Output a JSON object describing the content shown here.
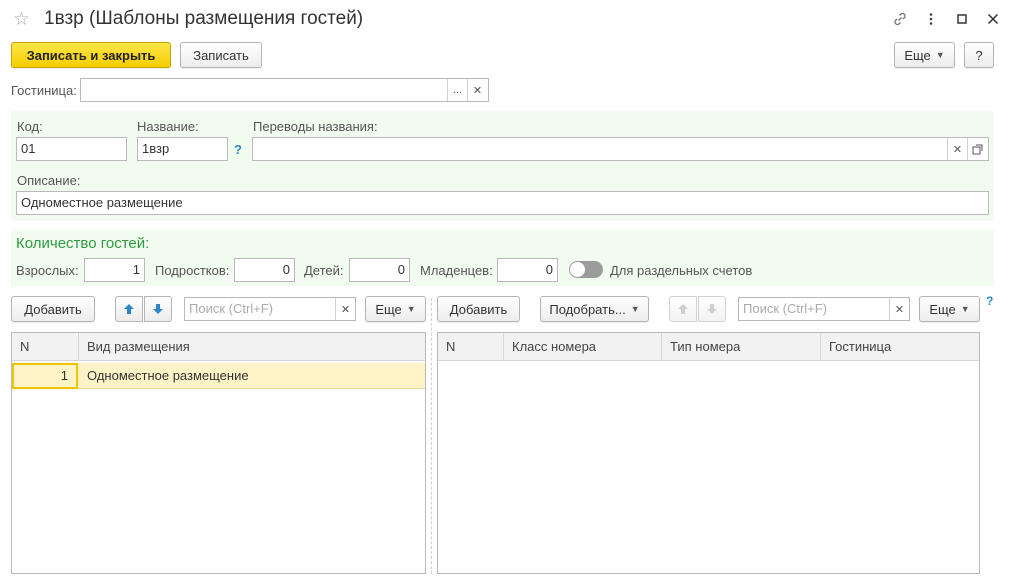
{
  "header": {
    "title": "1взр (Шаблоны размещения гостей)"
  },
  "toolbar": {
    "save_close": "Записать и закрыть",
    "save": "Записать",
    "more": "Еще",
    "help": "?"
  },
  "hotel": {
    "label": "Гостиница:",
    "value": "",
    "select_btn": "..."
  },
  "fields": {
    "code_label": "Код:",
    "code_value": "01",
    "name_label": "Название:",
    "name_value": "1взр",
    "name_help": "?",
    "translations_label": "Переводы названия:",
    "translations_value": "",
    "description_label": "Описание:",
    "description_value": "Одноместное размещение"
  },
  "guests": {
    "title": "Количество гостей:",
    "adults_label": "Взрослых:",
    "adults_value": "1",
    "teens_label": "Подростков:",
    "teens_value": "0",
    "children_label": "Детей:",
    "children_value": "0",
    "infants_label": "Младенцев:",
    "infants_value": "0",
    "separate_accounts_label": "Для раздельных счетов"
  },
  "left_table": {
    "add": "Добавить",
    "search_placeholder": "Поиск (Ctrl+F)",
    "more": "Еще",
    "columns": [
      "N",
      "Вид размещения"
    ],
    "rows": [
      {
        "n": "1",
        "type": "Одноместное размещение"
      }
    ]
  },
  "right_table": {
    "add": "Добавить",
    "pick": "Подобрать...",
    "search_placeholder": "Поиск (Ctrl+F)",
    "more": "Еще",
    "help": "?",
    "columns": [
      "N",
      "Класс номера",
      "Тип номера",
      "Гостиница"
    ]
  },
  "colors": {
    "primary_button": "#f5cd00",
    "section_title": "#2e9c40",
    "selected_row": "#fdf3c6",
    "arrow_blue": "#2b89c9"
  }
}
